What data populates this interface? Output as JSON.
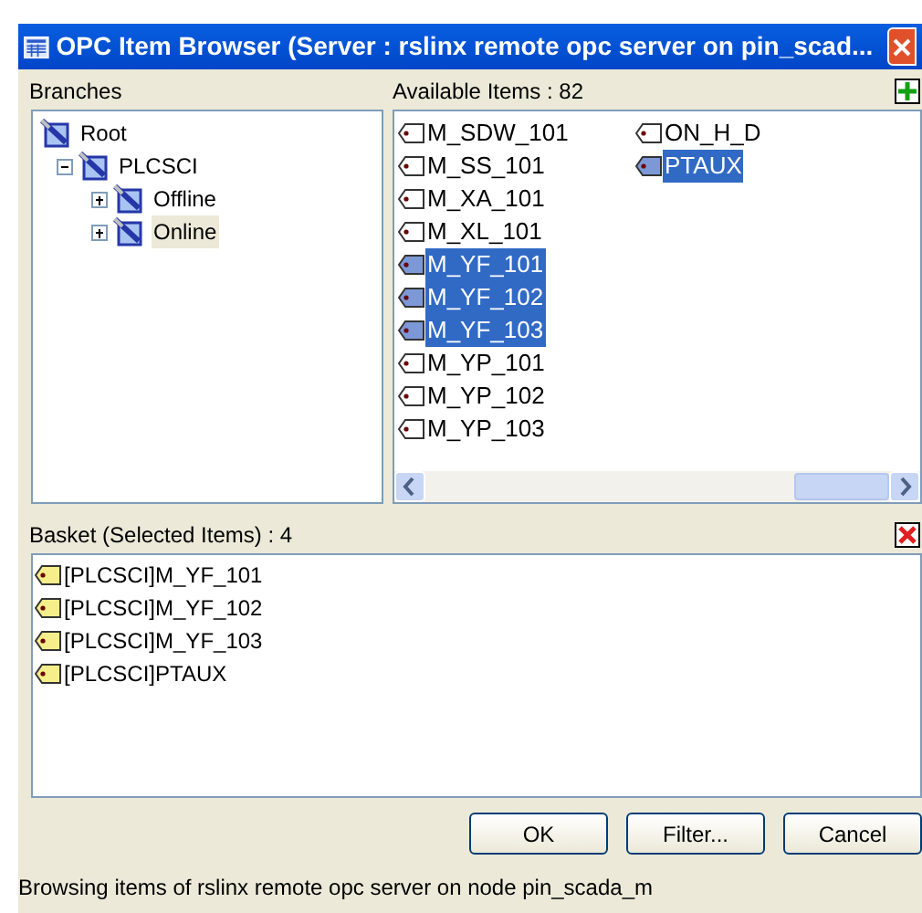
{
  "window": {
    "title": "OPC Item Browser (Server : rslinx remote opc server on pin_scad..."
  },
  "branches": {
    "label": "Branches",
    "tree": [
      {
        "label": "Root",
        "selected": false,
        "children": [
          {
            "label": "PLCSCI",
            "expanded": true,
            "selected": false,
            "children": [
              {
                "label": "Offline",
                "expanded": false,
                "selected": false
              },
              {
                "label": "Online",
                "expanded": false,
                "selected": true
              }
            ]
          }
        ]
      }
    ]
  },
  "available": {
    "label": "Available Items : 82",
    "columns": [
      [
        {
          "label": "M_SDW_101",
          "selected": false
        },
        {
          "label": "M_SS_101",
          "selected": false
        },
        {
          "label": "M_XA_101",
          "selected": false
        },
        {
          "label": "M_XL_101",
          "selected": false
        },
        {
          "label": "M_YF_101",
          "selected": true
        },
        {
          "label": "M_YF_102",
          "selected": true
        },
        {
          "label": "M_YF_103",
          "selected": true
        },
        {
          "label": "M_YP_101",
          "selected": false
        },
        {
          "label": "M_YP_102",
          "selected": false
        },
        {
          "label": "M_YP_103",
          "selected": false
        }
      ],
      [
        {
          "label": "ON_H_D",
          "selected": false
        },
        {
          "label": "PTAUX",
          "selected": true
        }
      ]
    ]
  },
  "basket": {
    "label": "Basket (Selected Items) : 4",
    "items": [
      "[PLCSCI]M_YF_101",
      "[PLCSCI]M_YF_102",
      "[PLCSCI]M_YF_103",
      "[PLCSCI]PTAUX"
    ]
  },
  "buttons": [
    "OK",
    "Filter...",
    "Cancel"
  ],
  "status_bar": "Browsing items of rslinx remote opc server on node pin_scada_m"
}
